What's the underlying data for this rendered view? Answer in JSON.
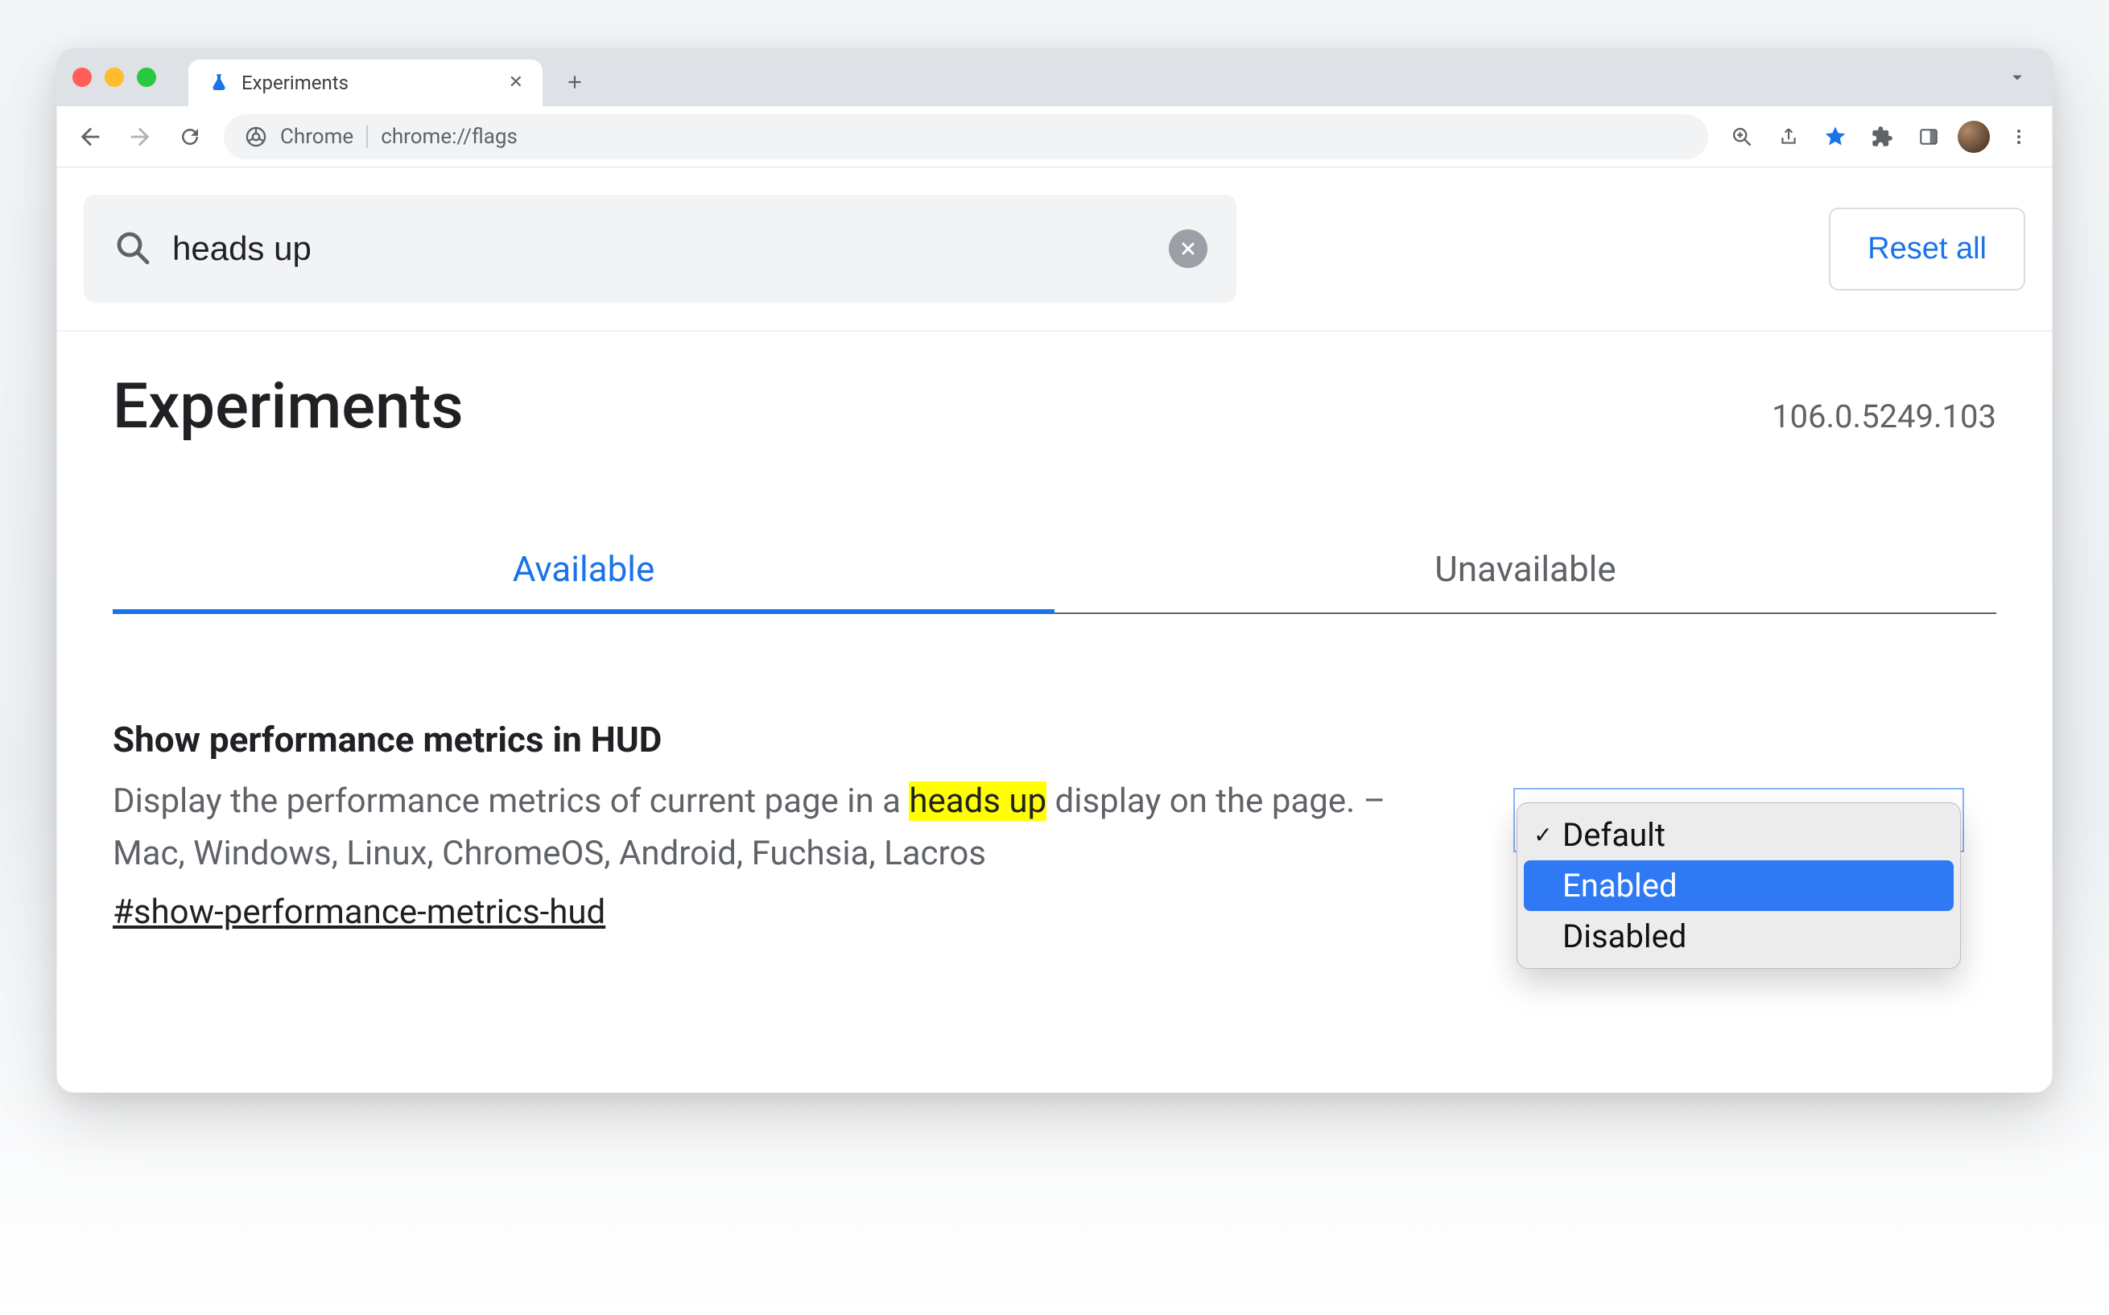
{
  "window": {
    "tab_title": "Experiments",
    "address_prefix": "Chrome",
    "address_url": "chrome://flags"
  },
  "search": {
    "value": "heads up",
    "reset_label": "Reset all"
  },
  "header": {
    "title": "Experiments",
    "version": "106.0.5249.103"
  },
  "tabs": {
    "available": "Available",
    "unavailable": "Unavailable"
  },
  "flag": {
    "title": "Show performance metrics in HUD",
    "desc_before": "Display the performance metrics of current page in a ",
    "desc_highlight": "heads up",
    "desc_after": " display on the page. – Mac, Windows, Linux, ChromeOS, Android, Fuchsia, Lacros",
    "anchor": "#show-performance-metrics-hud",
    "options": {
      "default": "Default",
      "enabled": "Enabled",
      "disabled": "Disabled"
    }
  }
}
